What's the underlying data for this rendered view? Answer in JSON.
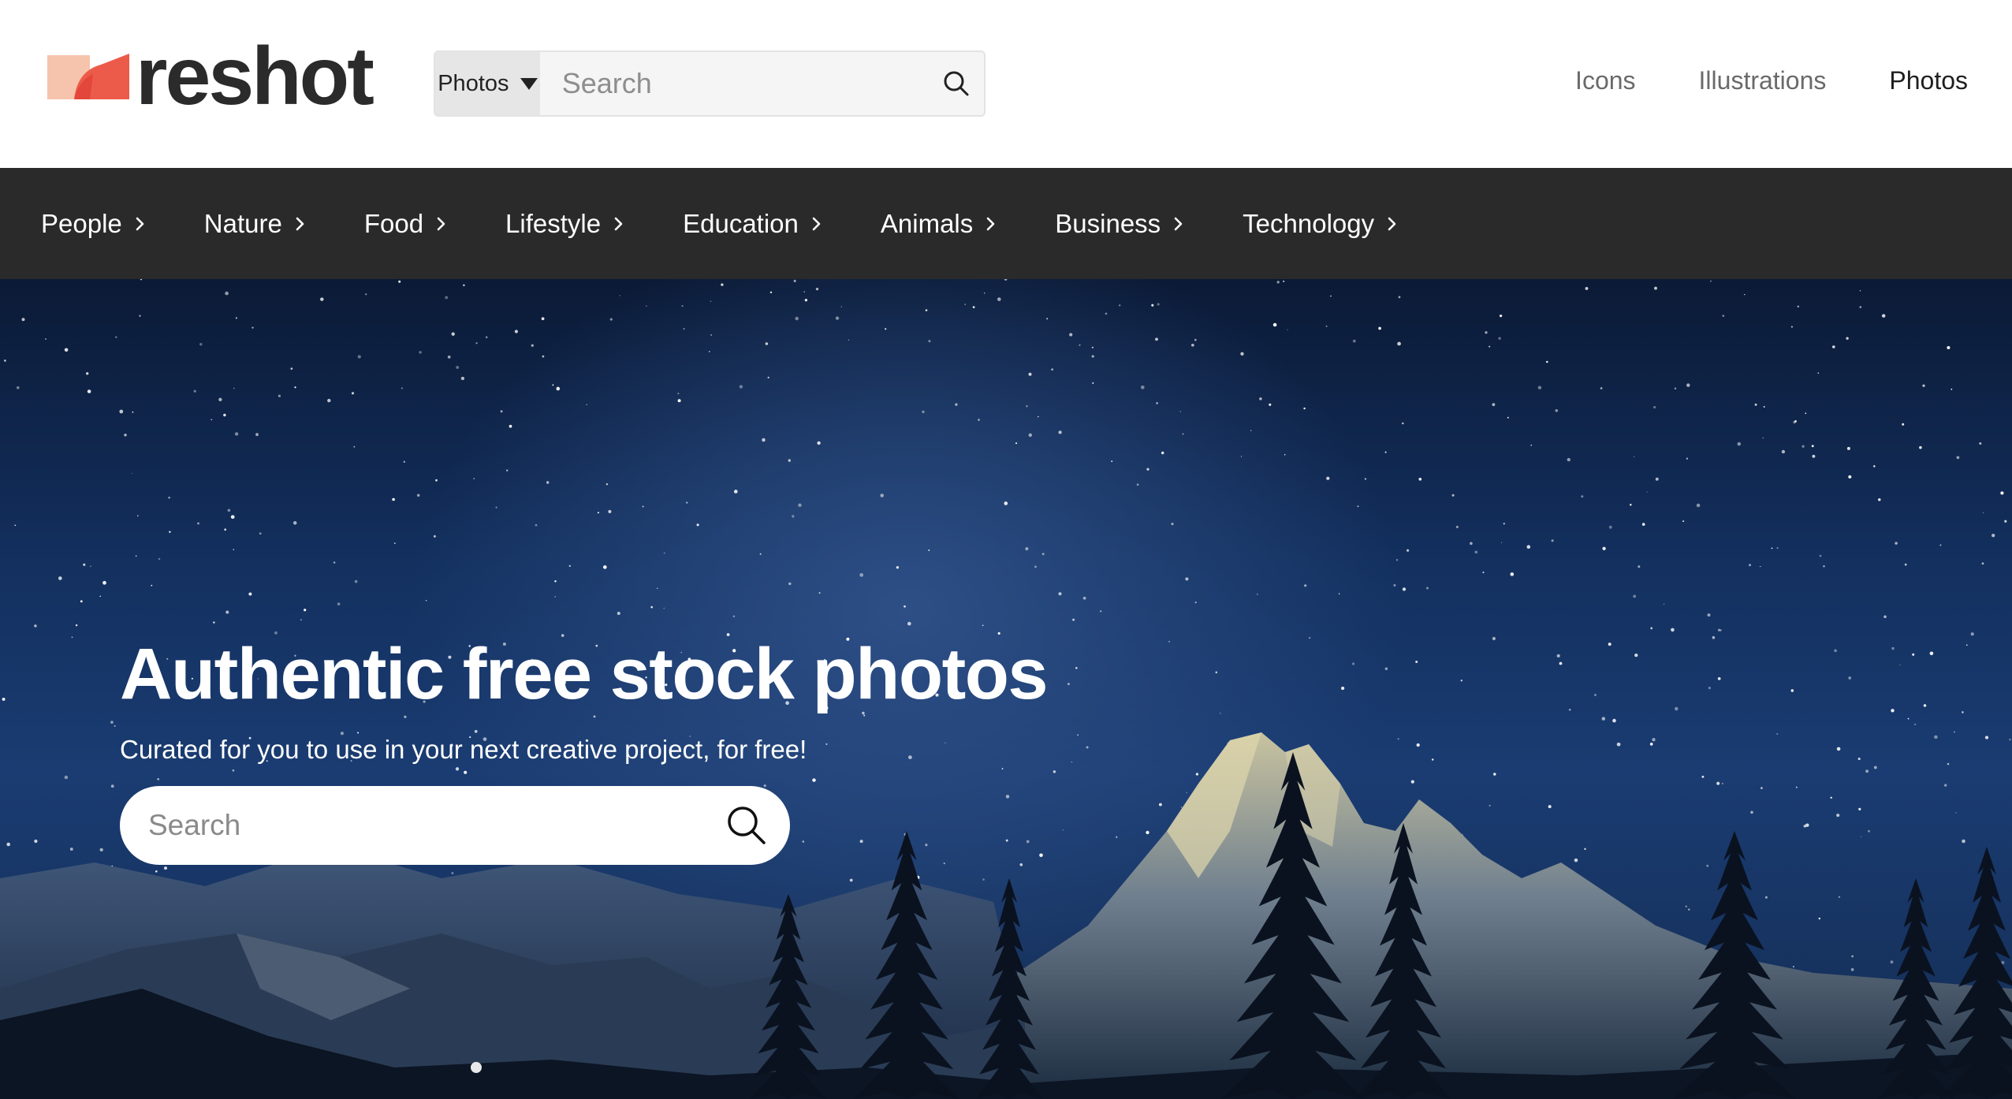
{
  "brand": {
    "name": "reshot",
    "colors": {
      "light": "#f6c3ad",
      "accent": "#ec5b4a",
      "dark": "#2b2b2b"
    }
  },
  "header_search": {
    "type_label": "Photos",
    "placeholder": "Search",
    "icon": "search-icon"
  },
  "nav": {
    "items": [
      {
        "label": "Icons"
      },
      {
        "label": "Illustrations"
      },
      {
        "label": "Photos"
      }
    ],
    "active": "Photos"
  },
  "categories": [
    {
      "label": "People"
    },
    {
      "label": "Nature"
    },
    {
      "label": "Food"
    },
    {
      "label": "Lifestyle"
    },
    {
      "label": "Education"
    },
    {
      "label": "Animals"
    },
    {
      "label": "Business"
    },
    {
      "label": "Technology"
    }
  ],
  "hero": {
    "title": "Authentic free stock photos",
    "subtitle": "Curated for you to use in your next creative project, for free!",
    "search_placeholder": "Search",
    "image": "starry night sky over mountains and pine trees"
  }
}
